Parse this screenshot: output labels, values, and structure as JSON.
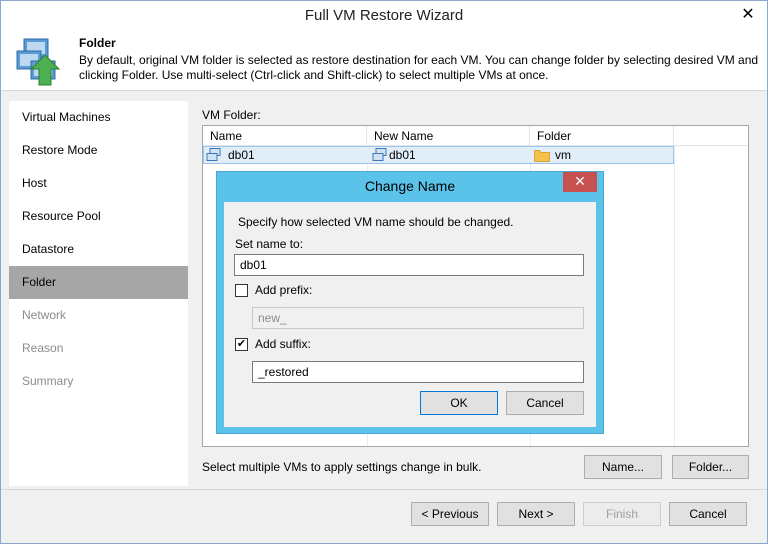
{
  "window": {
    "title": "Full VM Restore Wizard",
    "close_glyph": "✕"
  },
  "header": {
    "title": "Folder",
    "description": "By default, original VM folder is selected as restore destination for each VM. You can change folder by selecting desired VM and clicking Folder. Use multi-select (Ctrl-click and Shift-click) to select multiple VMs at once.",
    "icon": "vm-restore-icon"
  },
  "sidebar": {
    "items": [
      {
        "label": "Virtual Machines",
        "state": "normal"
      },
      {
        "label": "Restore Mode",
        "state": "normal"
      },
      {
        "label": "Host",
        "state": "normal"
      },
      {
        "label": "Resource Pool",
        "state": "normal"
      },
      {
        "label": "Datastore",
        "state": "normal"
      },
      {
        "label": "Folder",
        "state": "active"
      },
      {
        "label": "Network",
        "state": "disabled"
      },
      {
        "label": "Reason",
        "state": "disabled"
      },
      {
        "label": "Summary",
        "state": "disabled"
      }
    ]
  },
  "main": {
    "vm_folder_label": "VM Folder:",
    "columns": [
      "Name",
      "New Name",
      "Folder"
    ],
    "rows": [
      {
        "name": "db01",
        "new_name": "db01",
        "folder": "vm"
      }
    ],
    "bulk_note": "Select multiple VMs to apply settings change in bulk.",
    "name_button": "Name...",
    "folder_button": "Folder..."
  },
  "footer": {
    "previous": "< Previous",
    "next": "Next >",
    "finish": "Finish",
    "cancel": "Cancel"
  },
  "dialog": {
    "title": "Change Name",
    "close_glyph": "✕",
    "instruction": "Specify how selected VM name should be changed.",
    "set_name_label": "Set name to:",
    "set_name_value": "db01",
    "prefix_label": "Add prefix:",
    "prefix_checked": false,
    "prefix_value": "new_",
    "suffix_label": "Add suffix:",
    "suffix_checked": true,
    "suffix_check_glyph": "✔",
    "suffix_value": "_restored",
    "ok": "OK",
    "cancel": "Cancel"
  },
  "colors": {
    "dialog_frame": "#5bc3ea",
    "close_button": "#c75050",
    "selection": "#e1eef9",
    "active_nav": "#a6a6a6",
    "folder_icon": "#f5c24a"
  }
}
